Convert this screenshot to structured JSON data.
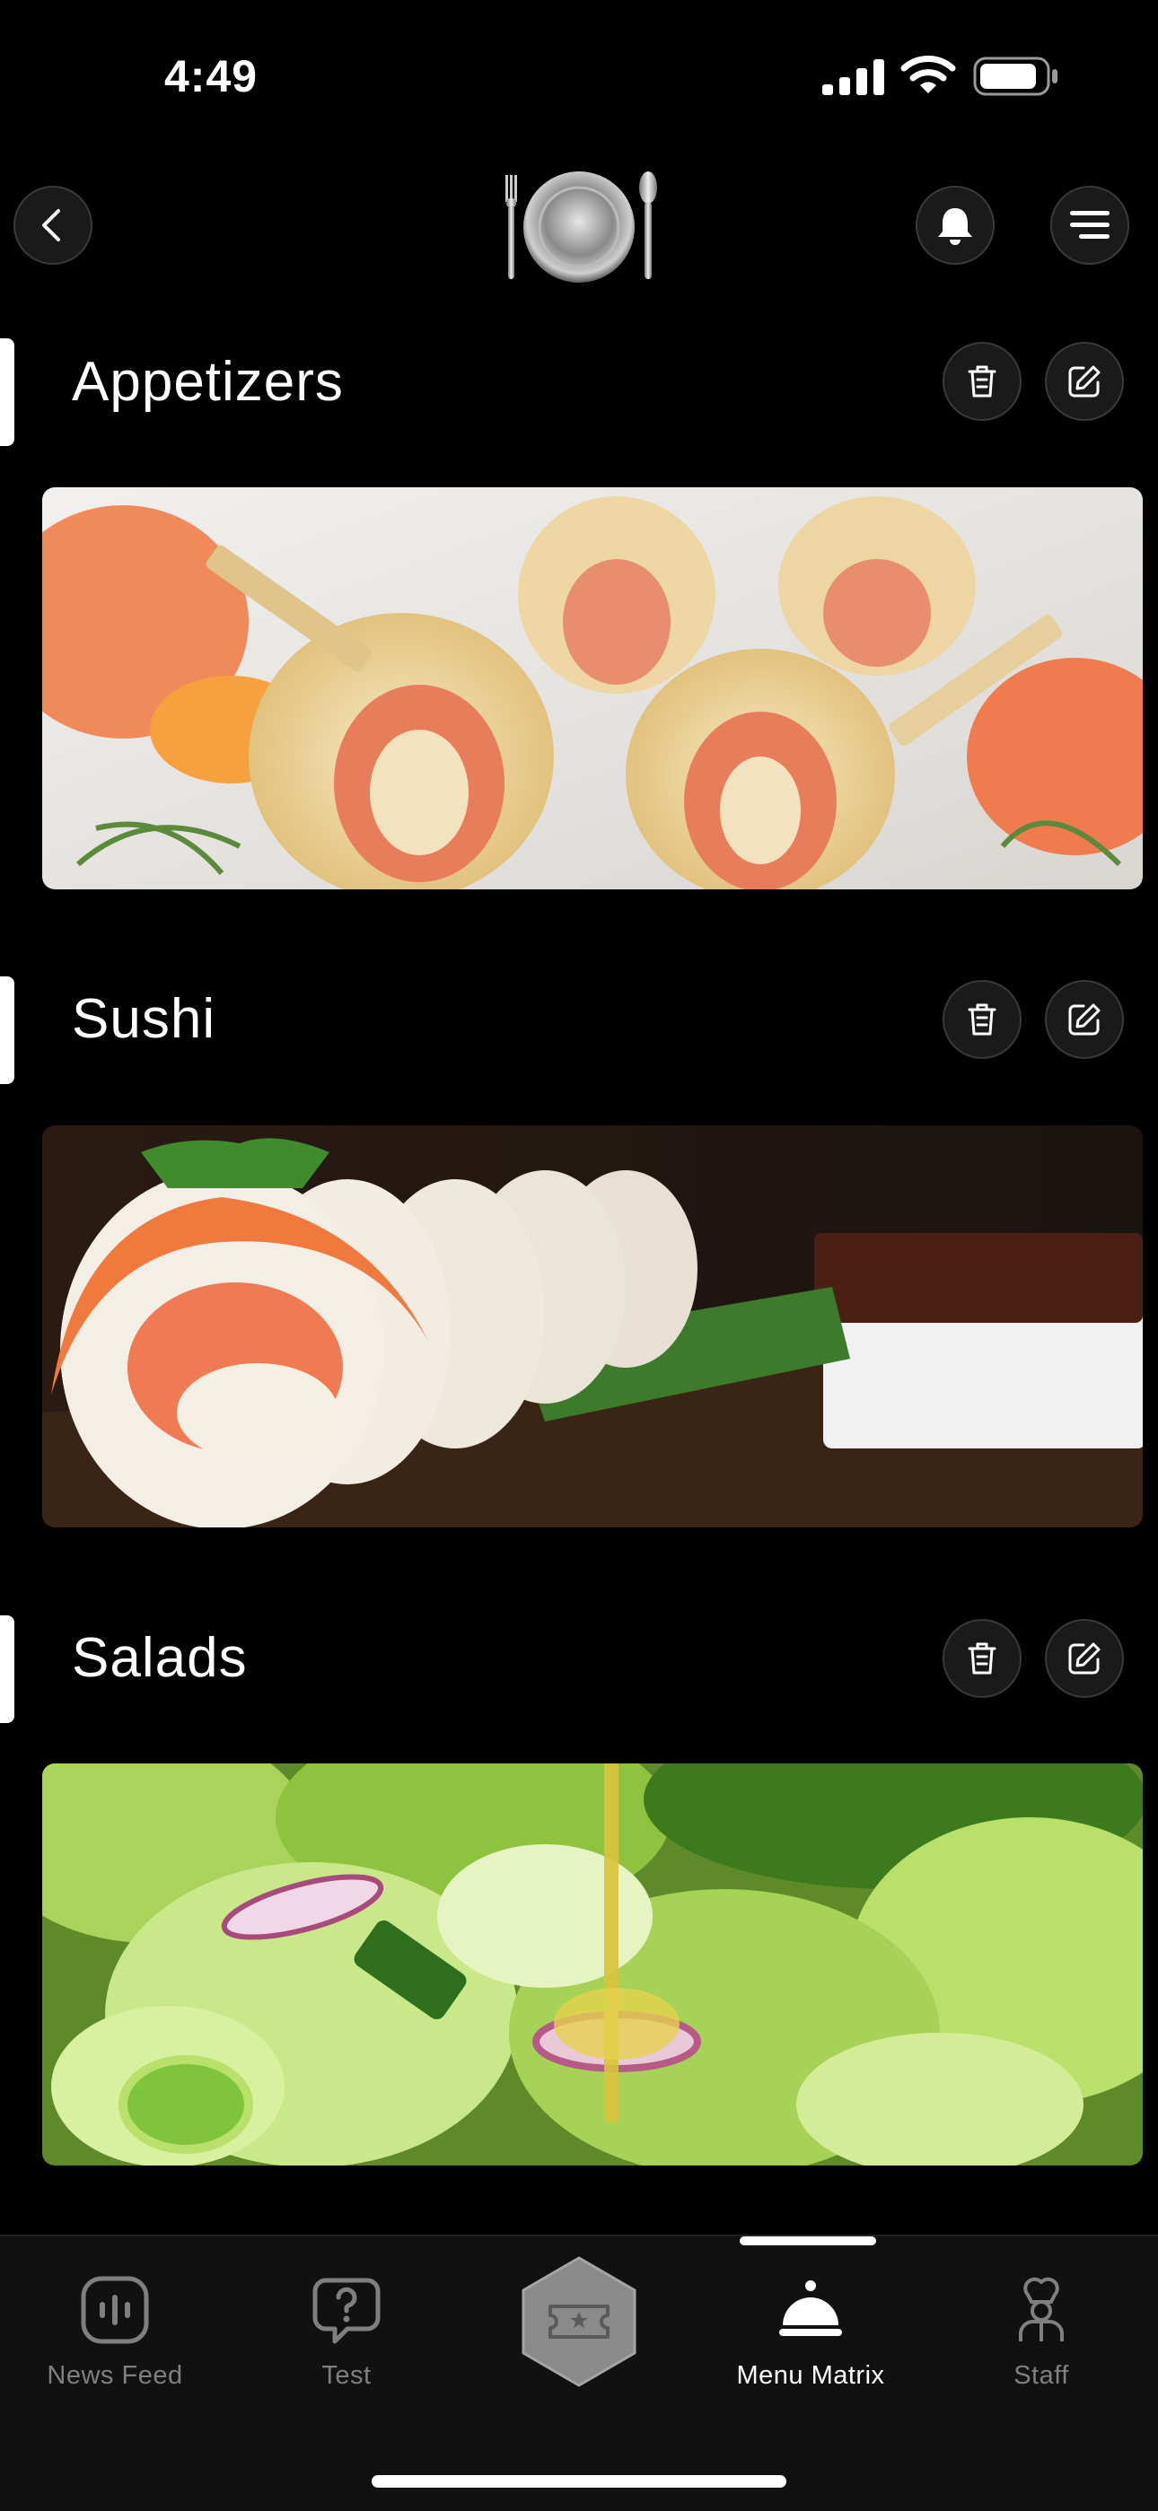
{
  "status_bar": {
    "time": "4:49"
  },
  "header": {
    "back_icon": "chevron-left-icon",
    "logo_icon": "plate-and-cutlery-logo",
    "bell_icon": "bell-icon",
    "menu_icon": "hamburger-menu-icon"
  },
  "sections": [
    {
      "title": "Appetizers",
      "image": "salmon crepe rolls photo"
    },
    {
      "title": "Sushi",
      "image": "salmon sushi rolls photo"
    },
    {
      "title": "Salads",
      "image": "green salad with olive oil photo"
    }
  ],
  "actions": {
    "delete_icon": "trash-icon",
    "edit_icon": "edit-pencil-icon"
  },
  "tabbar": {
    "items": [
      {
        "label": "News Feed",
        "icon": "news-feed-icon",
        "active": false
      },
      {
        "label": "Test",
        "icon": "question-bubble-icon",
        "active": false
      },
      {
        "label": "Menu Matrix",
        "icon": "cloche-icon",
        "active": true
      },
      {
        "label": "Staff",
        "icon": "chef-icon",
        "active": false
      }
    ],
    "center_icon": "ticket-star-icon"
  },
  "colors": {
    "background": "#000000",
    "accent": "#ffffff",
    "inactive": "#7f7f7f"
  }
}
